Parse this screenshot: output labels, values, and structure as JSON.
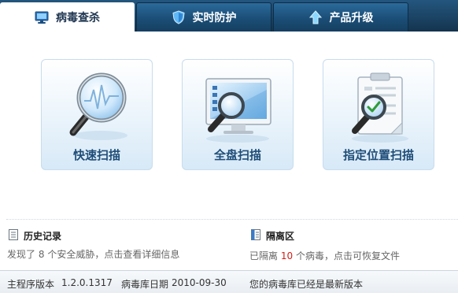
{
  "tabs": [
    {
      "label": "病毒查杀",
      "icon": "monitor-icon"
    },
    {
      "label": "实时防护",
      "icon": "shield-icon"
    },
    {
      "label": "产品升级",
      "icon": "up-arrow-icon"
    }
  ],
  "scan": {
    "quick_label": "快速扫描",
    "full_label": "全盘扫描",
    "custom_label": "指定位置扫描"
  },
  "history": {
    "title": "历史记录",
    "prefix": "发现了",
    "count": "8",
    "suffix": "个安全威胁，点击查看详细信息"
  },
  "quarantine": {
    "title": "隔离区",
    "prefix": "已隔离",
    "count": "10",
    "suffix": "个病毒，点击可恢复文件"
  },
  "status": {
    "version_label": "主程序版本",
    "version": "1.2.0.1317",
    "db_date_label": "病毒库日期",
    "db_date": "2010-09-30",
    "db_status": "您的病毒库已经是最新版本"
  },
  "colors": {
    "tabbar": "#1a4669",
    "card_label": "#1f4d78",
    "count_highlight": "#d0201a"
  }
}
